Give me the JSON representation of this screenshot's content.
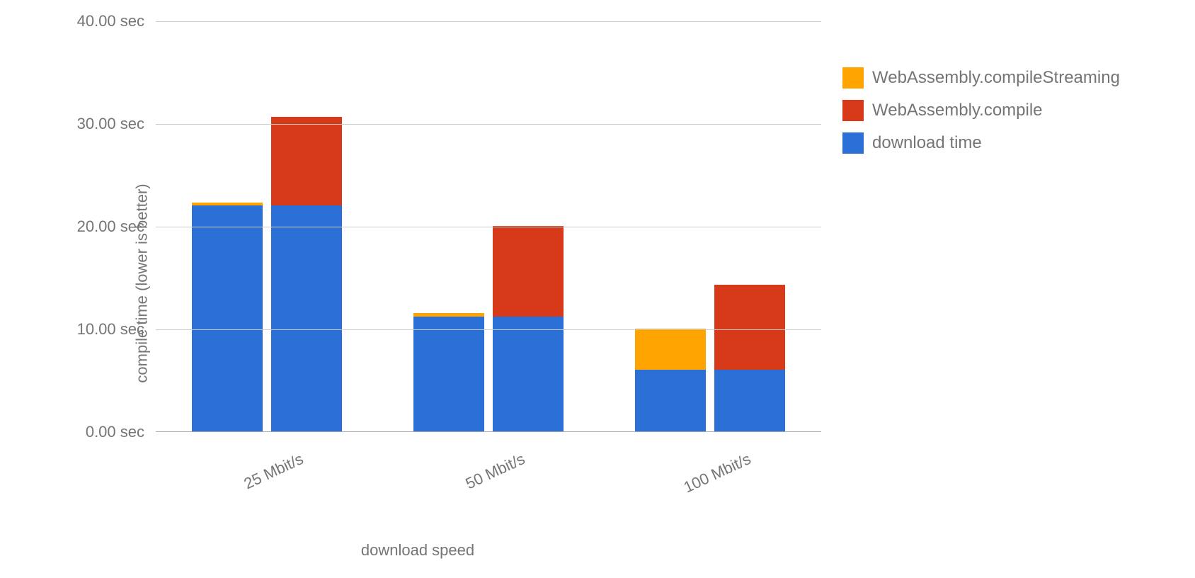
{
  "chart_data": {
    "type": "bar",
    "xlabel": "download speed",
    "ylabel": "compile time (lower is better)",
    "categories": [
      "25 Mbit/s",
      "50 Mbit/s",
      "100 Mbit/s"
    ],
    "y_ticks": [
      "0.00 sec",
      "10.00 sec",
      "20.00 sec",
      "30.00 sec",
      "40.00 sec"
    ],
    "y_tick_values": [
      0,
      10,
      20,
      30,
      40
    ],
    "ylim": [
      0,
      40
    ],
    "legend": [
      {
        "name": "WebAssembly.compileStreaming",
        "color": "#ffa400"
      },
      {
        "name": "WebAssembly.compile",
        "color": "#d73a18"
      },
      {
        "name": "download time",
        "color": "#2a70d6"
      }
    ],
    "colors": {
      "download": "#2a70d6",
      "compile": "#d73a18",
      "streaming": "#ffa400"
    },
    "groups": [
      {
        "category": "25 Mbit/s",
        "bars": [
          {
            "segments": [
              {
                "key": "download",
                "value": 22.0
              },
              {
                "key": "streaming",
                "value": 0.3
              }
            ]
          },
          {
            "segments": [
              {
                "key": "download",
                "value": 22.0
              },
              {
                "key": "compile",
                "value": 8.6
              }
            ]
          }
        ]
      },
      {
        "category": "50 Mbit/s",
        "bars": [
          {
            "segments": [
              {
                "key": "download",
                "value": 11.2
              },
              {
                "key": "streaming",
                "value": 0.3
              }
            ]
          },
          {
            "segments": [
              {
                "key": "download",
                "value": 11.2
              },
              {
                "key": "compile",
                "value": 8.8
              }
            ]
          }
        ]
      },
      {
        "category": "100 Mbit/s",
        "bars": [
          {
            "segments": [
              {
                "key": "download",
                "value": 6.0
              },
              {
                "key": "streaming",
                "value": 4.0
              }
            ]
          },
          {
            "segments": [
              {
                "key": "download",
                "value": 6.0
              },
              {
                "key": "compile",
                "value": 8.3
              }
            ]
          }
        ]
      }
    ]
  }
}
